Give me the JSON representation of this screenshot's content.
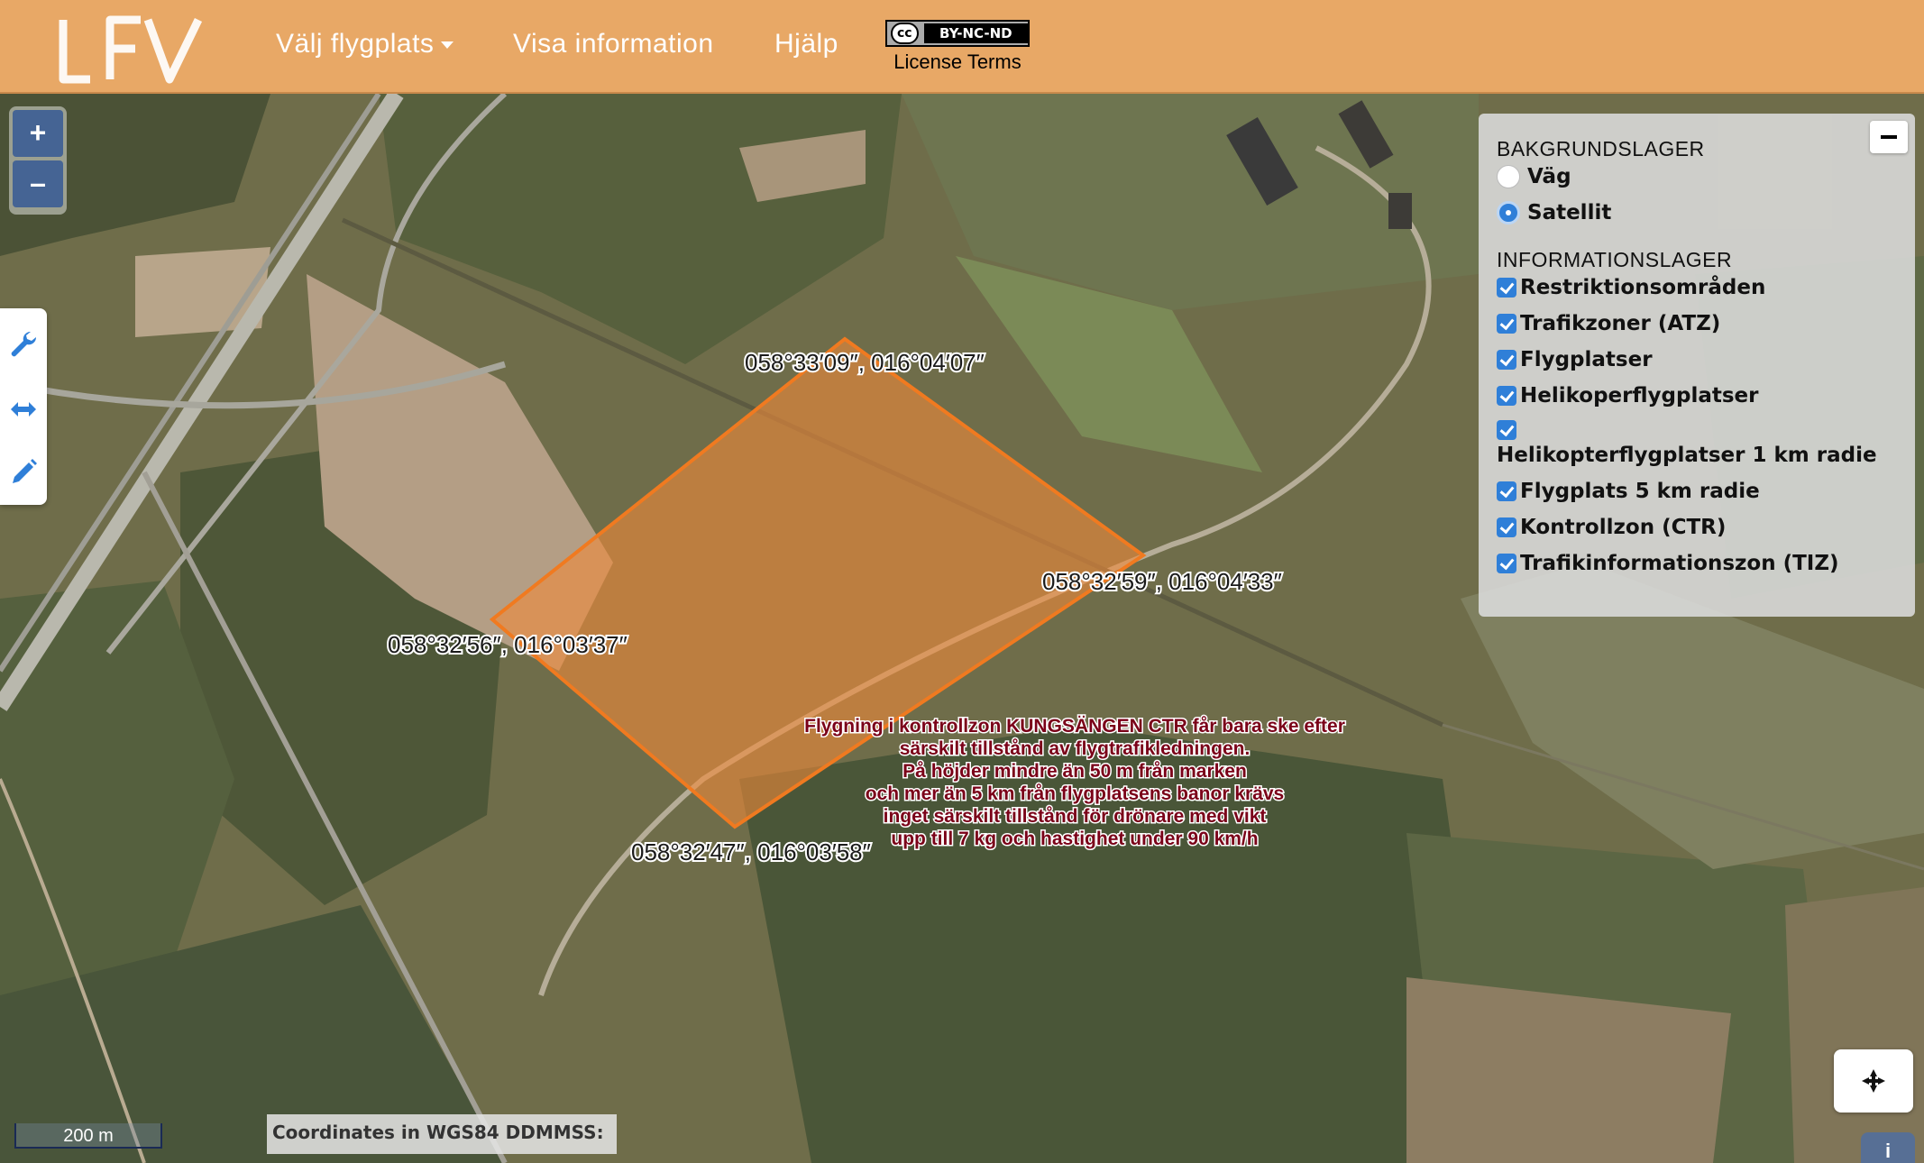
{
  "header": {
    "nav": {
      "select_airport": "Välj flygplats",
      "show_info": "Visa information",
      "help": "Hjälp"
    },
    "license": {
      "badge_cc": "cc",
      "badge_text": "BY-NC-ND",
      "label": "License Terms"
    }
  },
  "zoom": {
    "in": "+",
    "out": "–"
  },
  "layers": {
    "background_title": "BAKGRUNDSLAGER",
    "background": [
      {
        "label": "Väg",
        "selected": false
      },
      {
        "label": "Satellit",
        "selected": true
      }
    ],
    "info_title": "INFORMATIONSLAGER",
    "info": [
      {
        "label": "Restriktionsområden",
        "checked": true
      },
      {
        "label": "Trafikzoner (ATZ)",
        "checked": true
      },
      {
        "label": "Flygplatser",
        "checked": true
      },
      {
        "label": "Helikoperflygplatser",
        "checked": true
      },
      {
        "label": "Helikopterflygplatser 1 km radie",
        "checked": true
      },
      {
        "label": "Flygplats 5 km radie",
        "checked": true
      },
      {
        "label": "Kontrollzon (CTR)",
        "checked": true
      },
      {
        "label": "Trafikinformationszon (TIZ)",
        "checked": true
      }
    ]
  },
  "polygon": {
    "fill_color": "#f08a3a",
    "stroke_color": "#f07a20",
    "vertex_labels": [
      "058°33′09″, 016°04′07″",
      "058°32′59″, 016°04′33″",
      "058°32′56″, 016°03′37″",
      "058°32′47″, 016°03′58″"
    ]
  },
  "ctr_notice": [
    "Flygning i kontrollzon KUNGSÄNGEN CTR får bara ske efter",
    "särskilt tillstånd av flygtrafikledningen.",
    "På höjder mindre än 50 m från marken",
    "och mer än 5 km från flygplatsens banor krävs",
    "inget särskilt tillstånd för drönare med vikt",
    "upp till 7 kg och hastighet under 90 km/h"
  ],
  "scale_label": "200 m",
  "coords_label": "Coordinates in WGS84 DDMMSS:",
  "info_button": "i",
  "icons": [
    "wrench-icon",
    "measure-icon",
    "pencil-icon",
    "locate-icon"
  ]
}
